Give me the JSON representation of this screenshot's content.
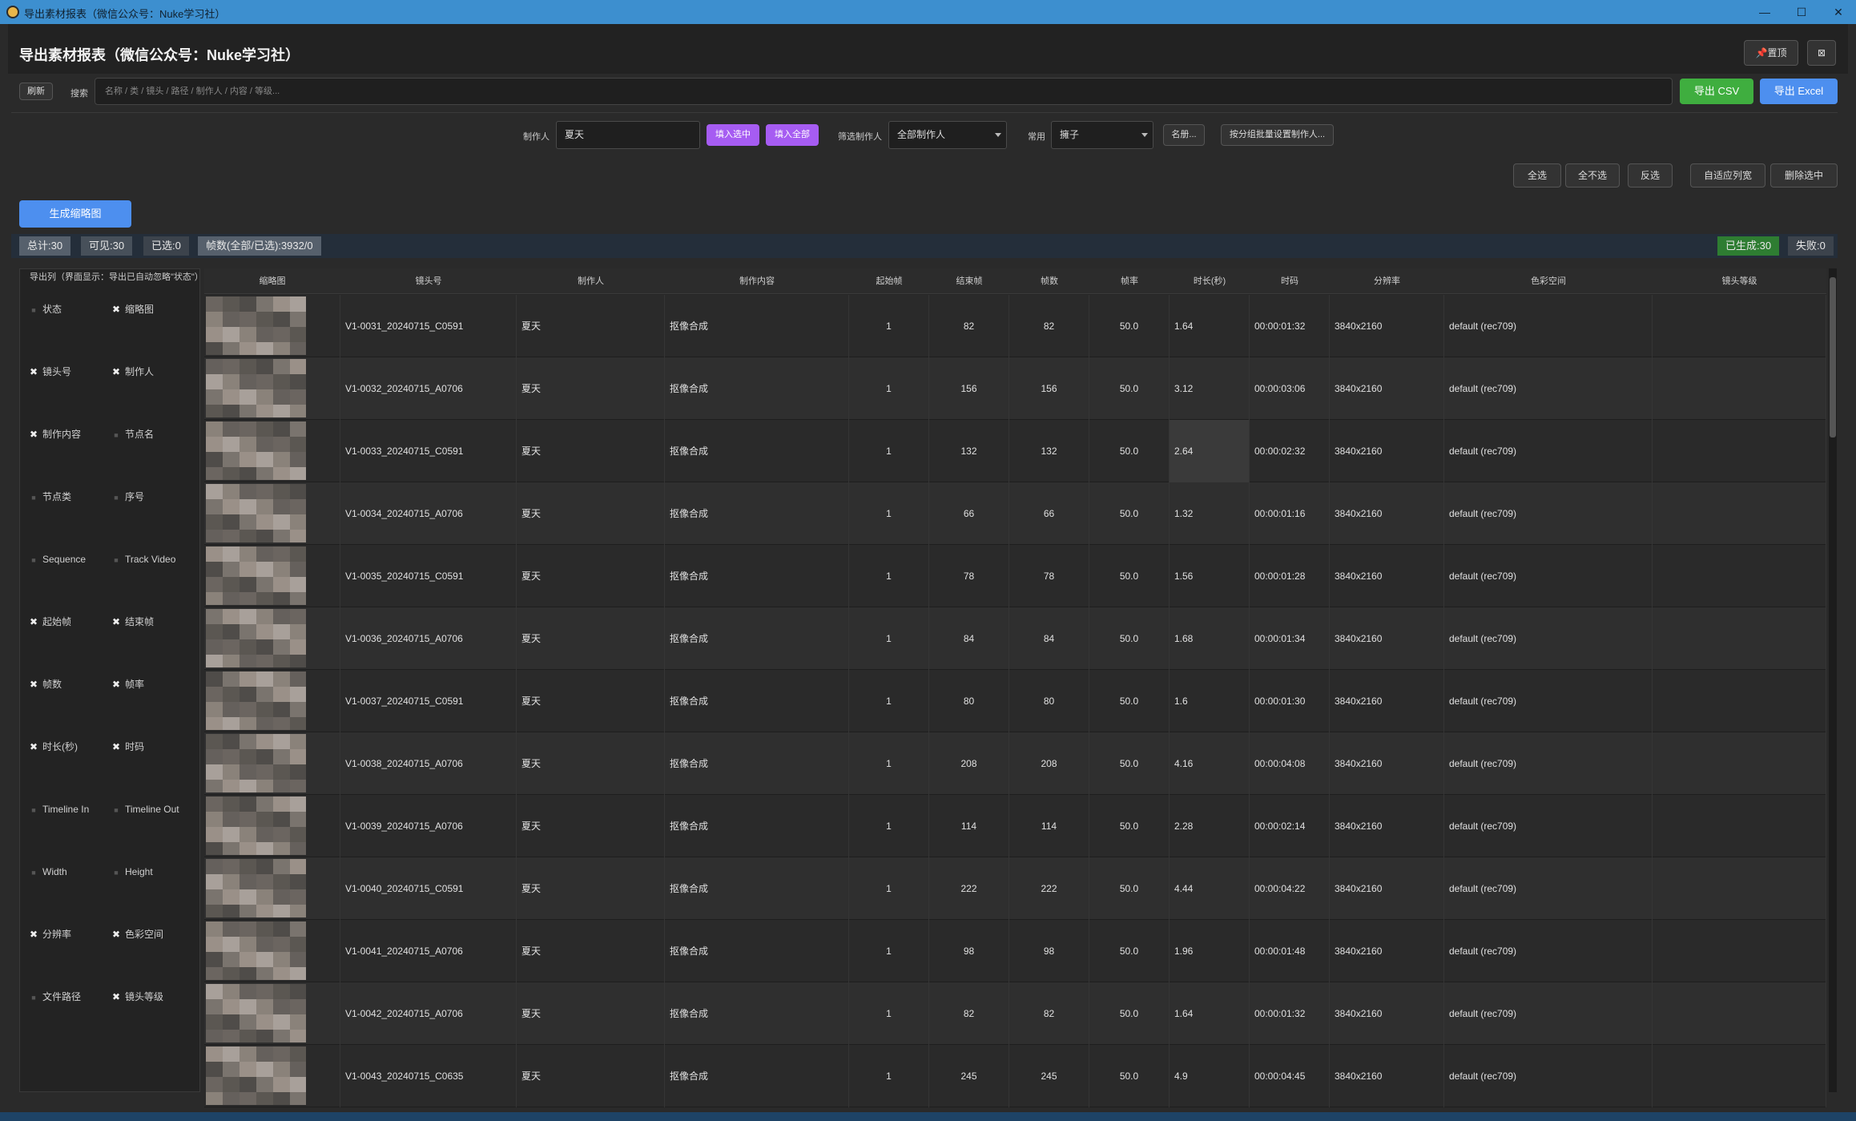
{
  "window": {
    "title": "导出素材报表（微信公众号：Nuke学习社）",
    "minimize": "—",
    "maximize": "☐",
    "close": "✕"
  },
  "header": {
    "title": "导出素材报表（微信公众号：Nuke学习社）",
    "pin_label": "📌置顶",
    "close_label": "⊠"
  },
  "toolbar": {
    "refresh_label": "刷新",
    "search_label": "搜索",
    "search_placeholder": "名称 / 类 / 镜头 / 路径 / 制作人 / 内容 / 等级...",
    "export_csv": "导出 CSV",
    "export_excel": "导出 Excel"
  },
  "producer": {
    "label": "制作人",
    "value": "夏天",
    "fill_selected": "填入选中",
    "fill_all": "填入全部",
    "filter_label": "筛选制作人",
    "filter_value": "全部制作人",
    "common_label": "常用",
    "common_value": "擁子",
    "list_btn": "名册...",
    "batch_btn": "按分组批量设置制作人..."
  },
  "selection": {
    "select_all": "全选",
    "select_none": "全不选",
    "invert": "反选",
    "auto_width": "自适应列宽",
    "delete_selected": "删除选中"
  },
  "generate_btn": "生成缩略图",
  "stats": {
    "total": "总计:30",
    "visible": "可见:30",
    "selected": "已选:0",
    "frames": "帧数(全部/已选):3932/0",
    "generated": "已生成:30",
    "failed": "失败:0"
  },
  "colpanel": {
    "title": "导出列（界面显示：导出已自动忽略\"状态\"）",
    "options": [
      {
        "label": "状态",
        "checked": false
      },
      {
        "label": "缩略图",
        "checked": true
      },
      {
        "label": "镜头号",
        "checked": true
      },
      {
        "label": "制作人",
        "checked": true
      },
      {
        "label": "制作内容",
        "checked": true
      },
      {
        "label": "节点名",
        "checked": false
      },
      {
        "label": "节点类",
        "checked": false
      },
      {
        "label": "序号",
        "checked": false
      },
      {
        "label": "Sequence",
        "checked": false
      },
      {
        "label": "Track Video",
        "checked": false
      },
      {
        "label": "起始帧",
        "checked": true
      },
      {
        "label": "结束帧",
        "checked": true
      },
      {
        "label": "帧数",
        "checked": true
      },
      {
        "label": "帧率",
        "checked": true
      },
      {
        "label": "时长(秒)",
        "checked": true
      },
      {
        "label": "时码",
        "checked": true
      },
      {
        "label": "Timeline In",
        "checked": false
      },
      {
        "label": "Timeline Out",
        "checked": false
      },
      {
        "label": "Width",
        "checked": false
      },
      {
        "label": "Height",
        "checked": false
      },
      {
        "label": "分辨率",
        "checked": true
      },
      {
        "label": "色彩空间",
        "checked": true
      },
      {
        "label": "文件路径",
        "checked": false
      },
      {
        "label": "镜头等级",
        "checked": true
      }
    ]
  },
  "table": {
    "columns": [
      "",
      "缩略图",
      "镜头号",
      "制作人",
      "制作内容",
      "起始帧",
      "结束帧",
      "帧数",
      "帧率",
      "时长(秒)",
      "时码",
      "分辨率",
      "色彩空间",
      "镜头等级"
    ],
    "rows": [
      {
        "shot": "V1-0031_20240715_C0591",
        "producer": "夏天",
        "content": "抠像合成",
        "start": "1",
        "end": "82",
        "frames": "82",
        "fps": "50.0",
        "dur": "1.64",
        "tc": "00:00:01:32",
        "res": "3840x2160",
        "cs": "default (rec709)",
        "level": ""
      },
      {
        "shot": "V1-0032_20240715_A0706",
        "producer": "夏天",
        "content": "抠像合成",
        "start": "1",
        "end": "156",
        "frames": "156",
        "fps": "50.0",
        "dur": "3.12",
        "tc": "00:00:03:06",
        "res": "3840x2160",
        "cs": "default (rec709)",
        "level": ""
      },
      {
        "shot": "V1-0033_20240715_C0591",
        "producer": "夏天",
        "content": "抠像合成",
        "start": "1",
        "end": "132",
        "frames": "132",
        "fps": "50.0",
        "dur": "2.64",
        "tc": "00:00:02:32",
        "res": "3840x2160",
        "cs": "default (rec709)",
        "level": ""
      },
      {
        "shot": "V1-0034_20240715_A0706",
        "producer": "夏天",
        "content": "抠像合成",
        "start": "1",
        "end": "66",
        "frames": "66",
        "fps": "50.0",
        "dur": "1.32",
        "tc": "00:00:01:16",
        "res": "3840x2160",
        "cs": "default (rec709)",
        "level": ""
      },
      {
        "shot": "V1-0035_20240715_C0591",
        "producer": "夏天",
        "content": "抠像合成",
        "start": "1",
        "end": "78",
        "frames": "78",
        "fps": "50.0",
        "dur": "1.56",
        "tc": "00:00:01:28",
        "res": "3840x2160",
        "cs": "default (rec709)",
        "level": ""
      },
      {
        "shot": "V1-0036_20240715_A0706",
        "producer": "夏天",
        "content": "抠像合成",
        "start": "1",
        "end": "84",
        "frames": "84",
        "fps": "50.0",
        "dur": "1.68",
        "tc": "00:00:01:34",
        "res": "3840x2160",
        "cs": "default (rec709)",
        "level": ""
      },
      {
        "shot": "V1-0037_20240715_C0591",
        "producer": "夏天",
        "content": "抠像合成",
        "start": "1",
        "end": "80",
        "frames": "80",
        "fps": "50.0",
        "dur": "1.6",
        "tc": "00:00:01:30",
        "res": "3840x2160",
        "cs": "default (rec709)",
        "level": ""
      },
      {
        "shot": "V1-0038_20240715_A0706",
        "producer": "夏天",
        "content": "抠像合成",
        "start": "1",
        "end": "208",
        "frames": "208",
        "fps": "50.0",
        "dur": "4.16",
        "tc": "00:00:04:08",
        "res": "3840x2160",
        "cs": "default (rec709)",
        "level": ""
      },
      {
        "shot": "V1-0039_20240715_A0706",
        "producer": "夏天",
        "content": "抠像合成",
        "start": "1",
        "end": "114",
        "frames": "114",
        "fps": "50.0",
        "dur": "2.28",
        "tc": "00:00:02:14",
        "res": "3840x2160",
        "cs": "default (rec709)",
        "level": ""
      },
      {
        "shot": "V1-0040_20240715_C0591",
        "producer": "夏天",
        "content": "抠像合成",
        "start": "1",
        "end": "222",
        "frames": "222",
        "fps": "50.0",
        "dur": "4.44",
        "tc": "00:00:04:22",
        "res": "3840x2160",
        "cs": "default (rec709)",
        "level": ""
      },
      {
        "shot": "V1-0041_20240715_A0706",
        "producer": "夏天",
        "content": "抠像合成",
        "start": "1",
        "end": "98",
        "frames": "98",
        "fps": "50.0",
        "dur": "1.96",
        "tc": "00:00:01:48",
        "res": "3840x2160",
        "cs": "default (rec709)",
        "level": ""
      },
      {
        "shot": "V1-0042_20240715_A0706",
        "producer": "夏天",
        "content": "抠像合成",
        "start": "1",
        "end": "82",
        "frames": "82",
        "fps": "50.0",
        "dur": "1.64",
        "tc": "00:00:01:32",
        "res": "3840x2160",
        "cs": "default (rec709)",
        "level": ""
      },
      {
        "shot": "V1-0043_20240715_C0635",
        "producer": "夏天",
        "content": "抠像合成",
        "start": "1",
        "end": "245",
        "frames": "245",
        "fps": "50.0",
        "dur": "4.9",
        "tc": "00:00:04:45",
        "res": "3840x2160",
        "cs": "default (rec709)",
        "level": ""
      }
    ]
  }
}
